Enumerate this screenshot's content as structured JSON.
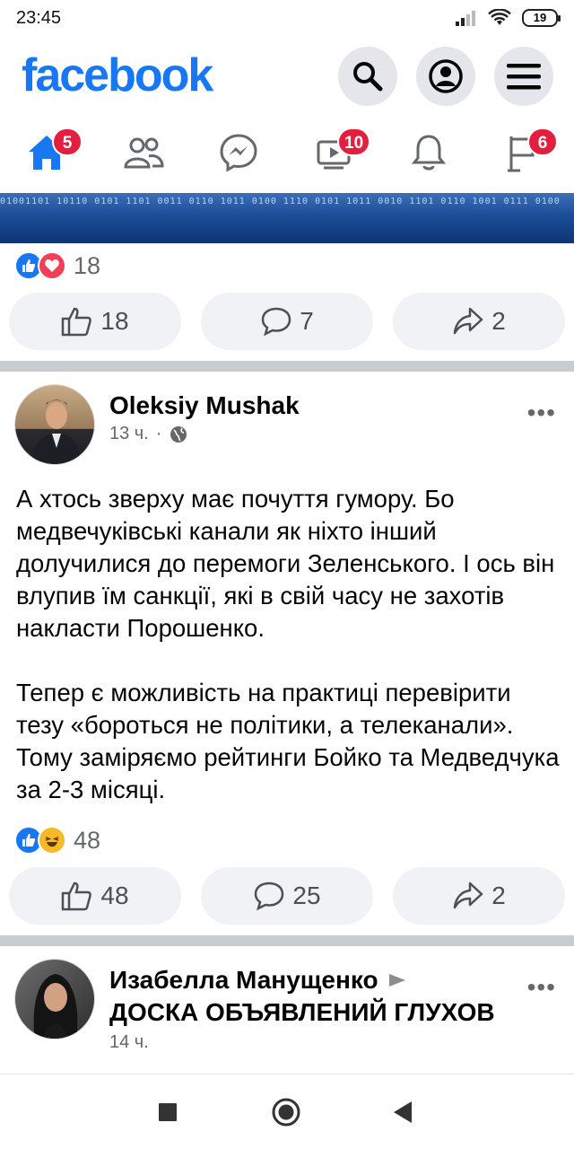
{
  "status_bar": {
    "time": "23:45",
    "battery": "19"
  },
  "header": {
    "logo": "facebook",
    "search_icon": "search-icon",
    "profile_icon": "profile-icon",
    "menu_icon": "menu-icon"
  },
  "nav": {
    "home_badge": "5",
    "video_badge": "10",
    "pages_badge": "6"
  },
  "post1": {
    "reaction_count": "18",
    "like_count": "18",
    "comment_count": "7",
    "share_count": "2"
  },
  "post2": {
    "author": "Oleksiy Mushak",
    "time": "13 ч.",
    "paragraph1": "А хтось зверху має почуття гумору. Бо медвечуківські канали як ніхто інший долучилися до перемоги Зеленського. І ось він влупив їм санкції, які в свій часу не захотів накласти Порошенко.",
    "paragraph2": "Тепер є можливість на практиці перевірити тезу «бороться не політики, а телеканали». Тому заміряємо рейтинги Бойко та Медведчука за 2-3 місяці.",
    "reaction_count": "48",
    "like_count": "48",
    "comment_count": "25",
    "share_count": "2"
  },
  "post3": {
    "author": "Изабелла Манущенко",
    "group": "ДОСКА ОБЪЯВЛЕНИЙ  ГЛУХОВ",
    "time": "14 ч."
  },
  "more_label": "•••",
  "colors": {
    "brand": "#1877f2",
    "badge": "#e41e3f",
    "button_bg": "#f0f2f5"
  }
}
